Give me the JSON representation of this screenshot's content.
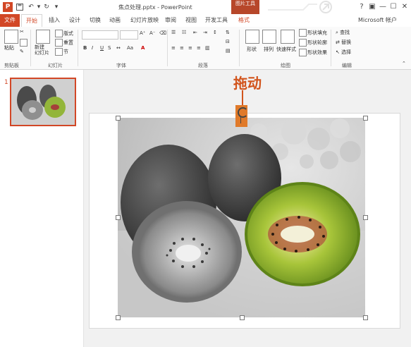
{
  "window": {
    "title": "焦点处理.pptx - PowerPoint",
    "contextual_tab_group": "图片工具",
    "help": "?",
    "minimize": "—",
    "close": "✕",
    "account": "Microsoft 帐户"
  },
  "qat": {
    "app_icon": "P",
    "save_icon": "save-icon",
    "undo_icon": "undo-icon",
    "redo_icon": "redo-icon",
    "customize": "▾"
  },
  "tabs": [
    "文件",
    "开始",
    "插入",
    "设计",
    "切换",
    "动画",
    "幻灯片放映",
    "审阅",
    "视图",
    "开发工具",
    "格式"
  ],
  "ribbon": {
    "clipboard": {
      "label": "剪贴板",
      "paste": "粘贴"
    },
    "slides": {
      "label": "幻灯片",
      "new_slide": "新建\n幻灯片",
      "layout": "版式",
      "reset": "重置",
      "section": "节"
    },
    "font": {
      "label": "字体",
      "bold": "B",
      "italic": "I",
      "underline": "U",
      "strike": "S",
      "aa": "Aa"
    },
    "paragraph": {
      "label": "段落"
    },
    "drawing": {
      "label": "绘图",
      "shapes": "形状",
      "arrange": "排列",
      "quick_styles": "快速样式",
      "fill": "形状填充",
      "outline": "形状轮廓",
      "effects": "形状效果"
    },
    "editing": {
      "label": "编辑",
      "find": "查找",
      "replace": "替换",
      "select": "选择"
    }
  },
  "thumbnail": {
    "number": "1"
  },
  "annotation": {
    "drag_label": "拖动"
  },
  "colors": {
    "accent": "#d24726",
    "callout": "#d2541c",
    "ribbon_bg": "#fafafa",
    "workspace": "#f1f1f1"
  }
}
